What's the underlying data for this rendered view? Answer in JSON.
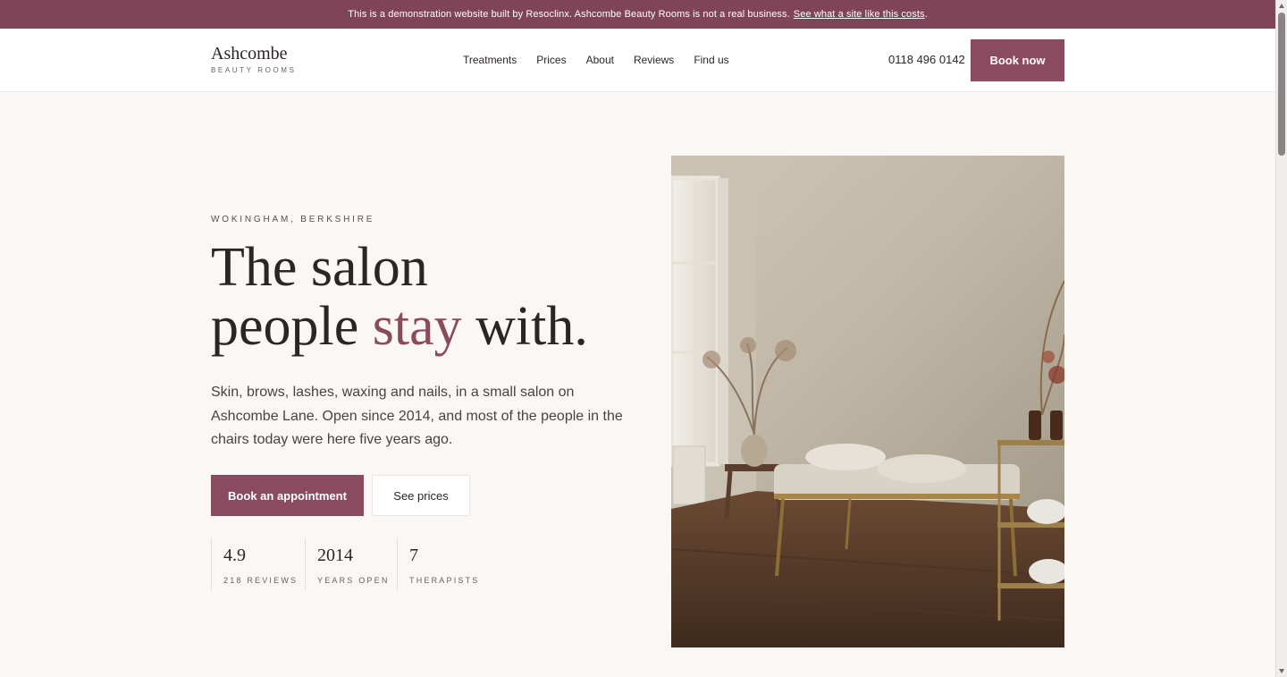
{
  "banner": {
    "message": "This is a demonstration website built by Resoclinx. Ashcombe Beauty Rooms is not a real business.",
    "link_label": "See what a site like this costs",
    "suffix": "."
  },
  "header": {
    "logo_name": "Ashcombe",
    "logo_sub": "BEAUTY ROOMS",
    "nav": [
      "Treatments",
      "Prices",
      "About",
      "Reviews",
      "Find us"
    ],
    "phone": "0118 496 0142",
    "book_label": "Book now"
  },
  "hero": {
    "eyebrow": "WOKINGHAM, BERKSHIRE",
    "headline_line1": "The salon",
    "headline_line2_start": "people ",
    "headline_accent": "stay",
    "headline_line2_end": " with.",
    "intro": "Skin, brows, lashes, waxing and nails, in a small salon on Ashcombe Lane. Open since 2014, and most of the people in the chairs today were here five years ago.",
    "primary_cta": "Book an appointment",
    "secondary_cta": "See prices",
    "stats": [
      {
        "value": "4.9",
        "label": "218 REVIEWS"
      },
      {
        "value": "2014",
        "label": "YEARS OPEN"
      },
      {
        "value": "7",
        "label": "THERAPISTS"
      }
    ],
    "image_icon": "salon-room-photo"
  },
  "colors": {
    "brand": "#8a4a5f",
    "banner": "#7f4457",
    "background": "#faf7f5",
    "text": "#2b2624"
  }
}
